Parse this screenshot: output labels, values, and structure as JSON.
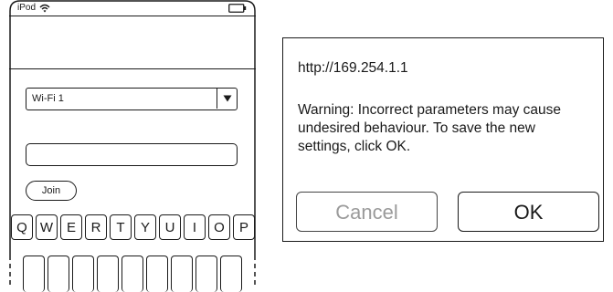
{
  "phone": {
    "status_bar": {
      "carrier": "iPod",
      "wifi_icon": "wifi-icon",
      "battery_icon": "battery-icon"
    },
    "wifi_select": {
      "value": "Wi-Fi 1",
      "arrow_icon": "triangle-down-icon"
    },
    "password_field": {
      "value": "",
      "placeholder": ""
    },
    "join_label": "Join",
    "keyboard": {
      "row1": [
        "Q",
        "W",
        "E",
        "R",
        "T",
        "Y",
        "U",
        "I",
        "O",
        "P"
      ]
    }
  },
  "dialog": {
    "title": "http://169.254.1.1",
    "message": "Warning: Incorrect parameters may cause undesired behaviour. To save the new settings, click OK.",
    "cancel_label": "Cancel",
    "ok_label": "OK",
    "colors": {
      "disabled_text": "#9a9a9a",
      "text": "#1a1a1a"
    }
  }
}
